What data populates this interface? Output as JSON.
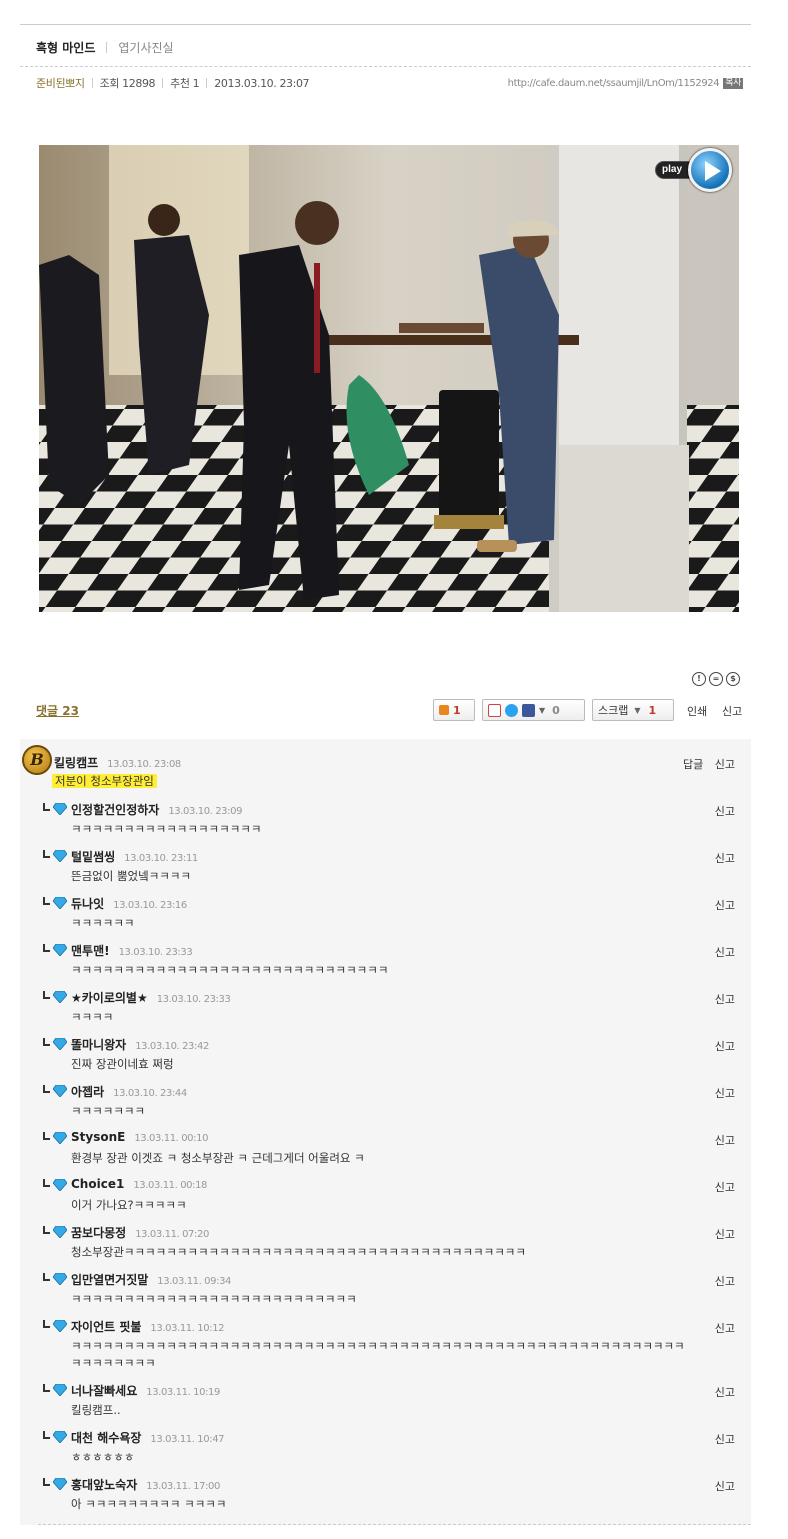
{
  "header": {
    "board_owner": "흑형 마인드",
    "board_name": "엽기사진실"
  },
  "meta": {
    "author": "준비된뽀지",
    "views_label": "조회 12898",
    "recommend_label": "추천 1",
    "datetime": "2013.03.10. 23:07",
    "url": "http://cafe.daum.net/ssaumjil/LnOm/1152924",
    "copy_label": "복사"
  },
  "media": {
    "play_label": "play"
  },
  "toolbar": {
    "comment_count_label": "댓글 23",
    "like_count": "1",
    "share_count": "0",
    "scrap_label": "스크랩",
    "scrap_count": "1",
    "print_label": "인쇄",
    "report_label": "신고"
  },
  "main_comment": {
    "badge_letter": "B",
    "author": "킬링캠프",
    "time": "13.03.10. 23:08",
    "text": "저분이 청소부장관임",
    "reply_label": "답글",
    "report_label": "신고"
  },
  "replies": [
    {
      "author": "인정할건인정하자",
      "time": "13.03.10. 23:09",
      "text": "ㅋㅋㅋㅋㅋㅋㅋㅋㅋㅋㅋㅋㅋㅋㅋㅋㅋㅋ",
      "report": "신고"
    },
    {
      "author": "털밑썸씽",
      "time": "13.03.10. 23:11",
      "text": "뜬금없이 뿜었넼ㅋㅋㅋㅋ",
      "report": "신고"
    },
    {
      "author": "듀나잇",
      "time": "13.03.10. 23:16",
      "text": "ㅋㅋㅋㅋㅋㅋ",
      "report": "신고"
    },
    {
      "author": "맨투맨!",
      "time": "13.03.10. 23:33",
      "text": "ㅋㅋㅋㅋㅋㅋㅋㅋㅋㅋㅋㅋㅋㅋㅋㅋㅋㅋㅋㅋㅋㅋㅋㅋㅋㅋㅋㅋㅋㅋ",
      "report": "신고"
    },
    {
      "author": "★카이로의별★",
      "time": "13.03.10. 23:33",
      "text": "ㅋㅋㅋㅋ",
      "report": "신고"
    },
    {
      "author": "똘마니왕자",
      "time": "13.03.10. 23:42",
      "text": "진짜 장관이네효 쩌렁",
      "report": "신고"
    },
    {
      "author": "아젭라",
      "time": "13.03.10. 23:44",
      "text": "ㅋㅋㅋㅋㅋㅋㅋ",
      "report": "신고"
    },
    {
      "author": "StysonE",
      "time": "13.03.11. 00:10",
      "text": "환경부 장관 이겟죠 ㅋ 청소부장관 ㅋ 근데그게더 어울려요 ㅋ",
      "report": "신고"
    },
    {
      "author": "Choice1",
      "time": "13.03.11. 00:18",
      "text": "이거 가나요?ㅋㅋㅋㅋㅋ",
      "report": "신고"
    },
    {
      "author": "꿈보다몽정",
      "time": "13.03.11. 07:20",
      "text": "청소부장관ㅋㅋㅋㅋㅋㅋㅋㅋㅋㅋㅋㅋㅋㅋㅋㅋㅋㅋㅋㅋㅋㅋㅋㅋㅋㅋㅋㅋㅋㅋㅋㅋㅋㅋㅋㅋㅋㅋ",
      "report": "신고"
    },
    {
      "author": "입만열면거짓말",
      "time": "13.03.11. 09:34",
      "text": "ㅋㅋㅋㅋㅋㅋㅋㅋㅋㅋㅋㅋㅋㅋㅋㅋㅋㅋㅋㅋㅋㅋㅋㅋㅋㅋㅋ",
      "report": "신고"
    },
    {
      "author": "자이언트 핏불",
      "time": "13.03.11. 10:12",
      "text": "ㅋㅋㅋㅋㅋㅋㅋㅋㅋㅋㅋㅋㅋㅋㅋㅋㅋㅋㅋㅋㅋㅋㅋㅋㅋㅋㅋㅋㅋㅋㅋㅋㅋㅋㅋㅋㅋㅋㅋㅋㅋㅋㅋㅋㅋㅋㅋㅋㅋㅋㅋㅋㅋㅋㅋㅋㅋㅋ",
      "text2": "ㅋㅋㅋㅋㅋㅋㅋㅋ",
      "report": "신고"
    },
    {
      "author": "너나잘빠세요",
      "time": "13.03.11. 10:19",
      "text": "킬링캠프..",
      "report": "신고"
    },
    {
      "author": "대천 해수욕장",
      "time": "13.03.11. 10:47",
      "text": "ㅎㅎㅎㅎㅎㅎ",
      "report": "신고"
    },
    {
      "author": "홍대앞노숙자",
      "time": "13.03.11. 17:00",
      "text": "아 ㅋㅋㅋㅋㅋㅋㅋㅋㅋ ㅋㅋㅋㅋ",
      "report": "신고"
    }
  ]
}
